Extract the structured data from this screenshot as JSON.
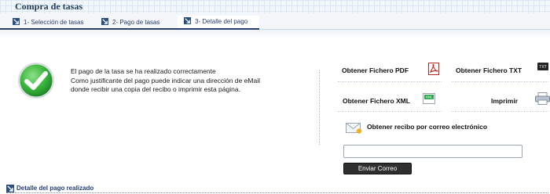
{
  "header": {
    "title": "Compra de tasas"
  },
  "tabs": [
    {
      "label": "1- Selección de tasas"
    },
    {
      "label": "2- Pago de tasas"
    },
    {
      "label": "3- Detalle del pago"
    }
  ],
  "message": {
    "line1": "El pago de la tasa se ha realizado correctamente",
    "line2": "Como justificante del pago puede indicar una dirección de eMail",
    "line3": "donde recibir una copia del recibo o imprimir esta página."
  },
  "actions": {
    "pdf": "Obtener Fichero PDF",
    "txt": "Obtener Fichero TXT",
    "xml": "Obtener Fichero XML",
    "print": "Imprimir",
    "email": "Obtener recibo por correo electrónico"
  },
  "email_form": {
    "value": "",
    "placeholder": "",
    "send_label": "Enviar Correo"
  },
  "detail": {
    "label": "Detalle del pago realizado"
  },
  "icons": {
    "txt_icon_text": "TXT",
    "xml_icon_text": "XML"
  },
  "colors": {
    "accent": "#2b3f6a",
    "success": "#35b33a",
    "pdf": "#c0281d"
  }
}
